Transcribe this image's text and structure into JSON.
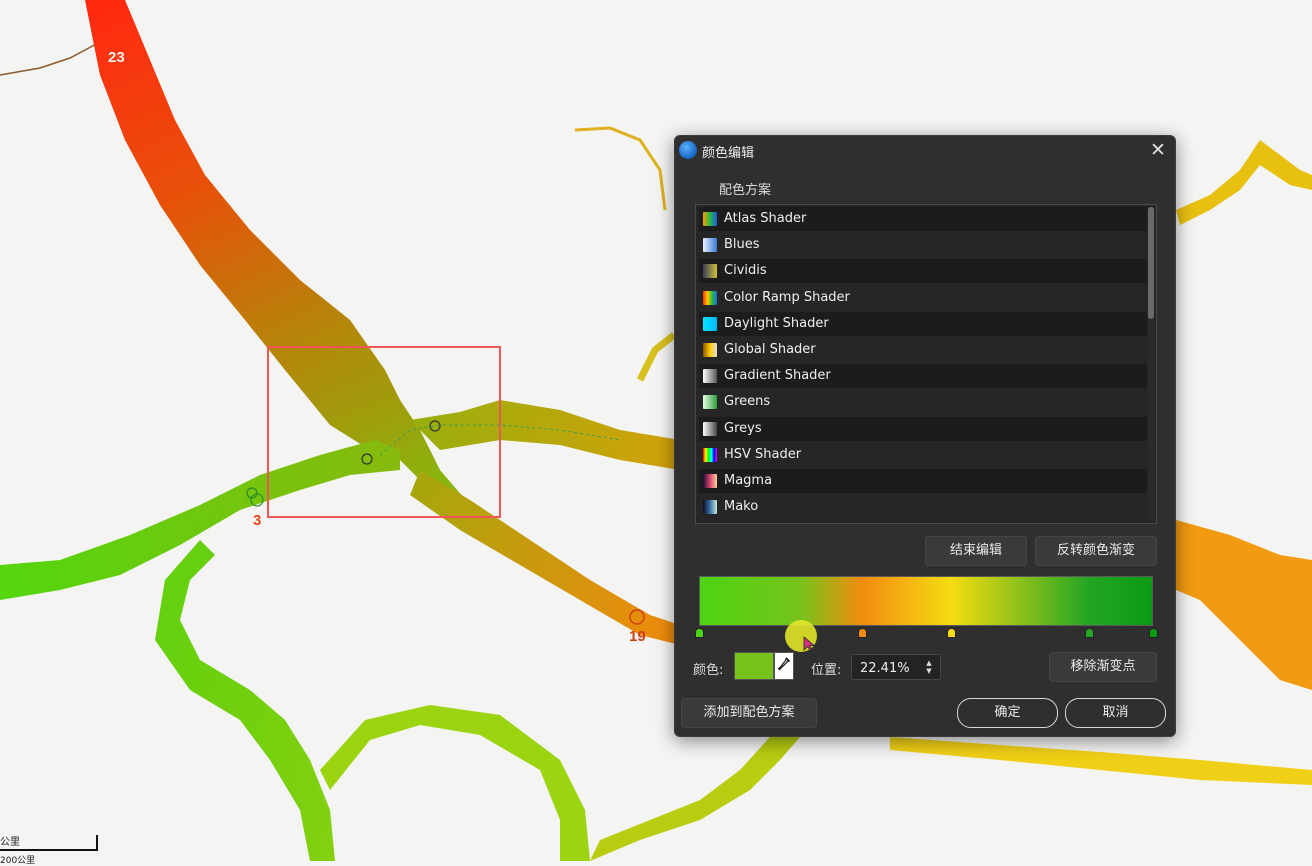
{
  "map": {
    "labels": [
      "23",
      "3",
      "19"
    ],
    "scale": {
      "top": "公里",
      "bottom": "200公里"
    }
  },
  "dialog": {
    "title": "颜色编辑",
    "close_icon": "close-icon",
    "scheme_section_label": "配色方案",
    "schemes": [
      {
        "name": "Atlas Shader",
        "swatch": [
          "#ff9900",
          "#22bb44",
          "#2255dd"
        ]
      },
      {
        "name": "Blues",
        "swatch": [
          "#e8f0ff",
          "#3a7bd5"
        ]
      },
      {
        "name": "Cividis",
        "swatch": [
          "#3a3f5a",
          "#cfc03a"
        ]
      },
      {
        "name": "Color Ramp Shader",
        "swatch": [
          "#ff3300",
          "#ffcc00",
          "#22bb44",
          "#2266ee"
        ]
      },
      {
        "name": "Daylight Shader",
        "swatch": [
          "#00e5ff",
          "#00b8ff"
        ]
      },
      {
        "name": "Global Shader",
        "swatch": [
          "#8a5a00",
          "#ffcc00",
          "#e0e0e0"
        ]
      },
      {
        "name": "Gradient Shader",
        "swatch": [
          "#ffffff",
          "#555555"
        ]
      },
      {
        "name": "Greens",
        "swatch": [
          "#e5ffe5",
          "#2e9e3e"
        ]
      },
      {
        "name": "Greys",
        "swatch": [
          "#ffffff",
          "#444444"
        ]
      },
      {
        "name": "HSV Shader",
        "swatch": [
          "#ff0000",
          "#ffff00",
          "#00ff00",
          "#00ffff",
          "#0000ff",
          "#ff00ff"
        ]
      },
      {
        "name": "Magma",
        "swatch": [
          "#1a0b3a",
          "#d6456e",
          "#fcd2a0"
        ]
      },
      {
        "name": "Mako",
        "swatch": [
          "#0b0d24",
          "#3a6ea5",
          "#c9ecd9"
        ]
      }
    ],
    "buttons": {
      "end_edit": "结束编辑",
      "reverse_gradient": "反转颜色渐变",
      "remove_stop": "移除渐变点",
      "add_to_scheme": "添加到配色方案",
      "ok": "确定",
      "cancel": "取消"
    },
    "gradient": {
      "stops": [
        {
          "pos": 0.0,
          "color": "#4cd412"
        },
        {
          "pos": 0.2241,
          "color": "#77c21b",
          "active": true
        },
        {
          "pos": 0.358,
          "color": "#f28c0f"
        },
        {
          "pos": 0.556,
          "color": "#f5dc10"
        },
        {
          "pos": 0.858,
          "color": "#25a524"
        },
        {
          "pos": 1.0,
          "color": "#0a9a12"
        }
      ]
    },
    "color_label": "颜色:",
    "current_color": "#77c21b",
    "eyedropper_icon": "eyedropper-icon",
    "position_label": "位置:",
    "position_value": "22.41%"
  }
}
